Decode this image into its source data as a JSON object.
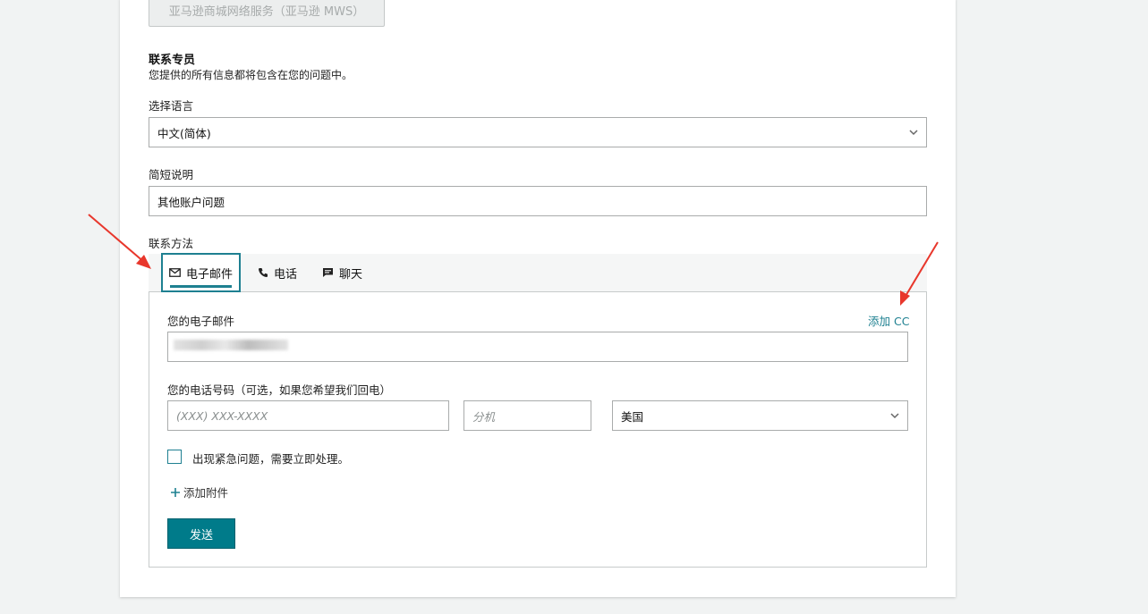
{
  "service_button": {
    "label": "亚马逊商城网络服务（亚马逊 MWS）"
  },
  "contact": {
    "title": "联系专员",
    "subtitle": "您提供的所有信息都将包含在您的问题中。"
  },
  "language": {
    "label": "选择语言",
    "value": "中文(简体)"
  },
  "description": {
    "label": "简短说明",
    "value": "其他账户问题"
  },
  "method": {
    "label": "联系方法",
    "tabs": [
      {
        "label": "电子邮件",
        "icon": "envelope-icon",
        "active": true
      },
      {
        "label": "电话",
        "icon": "phone-icon",
        "active": false
      },
      {
        "label": "聊天",
        "icon": "chat-bubble-icon",
        "active": false
      }
    ]
  },
  "email": {
    "label": "您的电子邮件",
    "add_cc": "添加 CC"
  },
  "phone": {
    "label": "您的电话号码（可选，如果您希望我们回电）",
    "number_placeholder": "(XXX) XXX-XXXX",
    "ext_placeholder": "分机",
    "country_value": "美国"
  },
  "urgent": {
    "label": "出现紧急问题，需要立即处理。"
  },
  "attach": {
    "label": "添加附件"
  },
  "send": {
    "label": "发送"
  },
  "colors": {
    "accent": "#1e8091",
    "button": "#007b8a",
    "annotation_arrow": "#e8372c"
  }
}
